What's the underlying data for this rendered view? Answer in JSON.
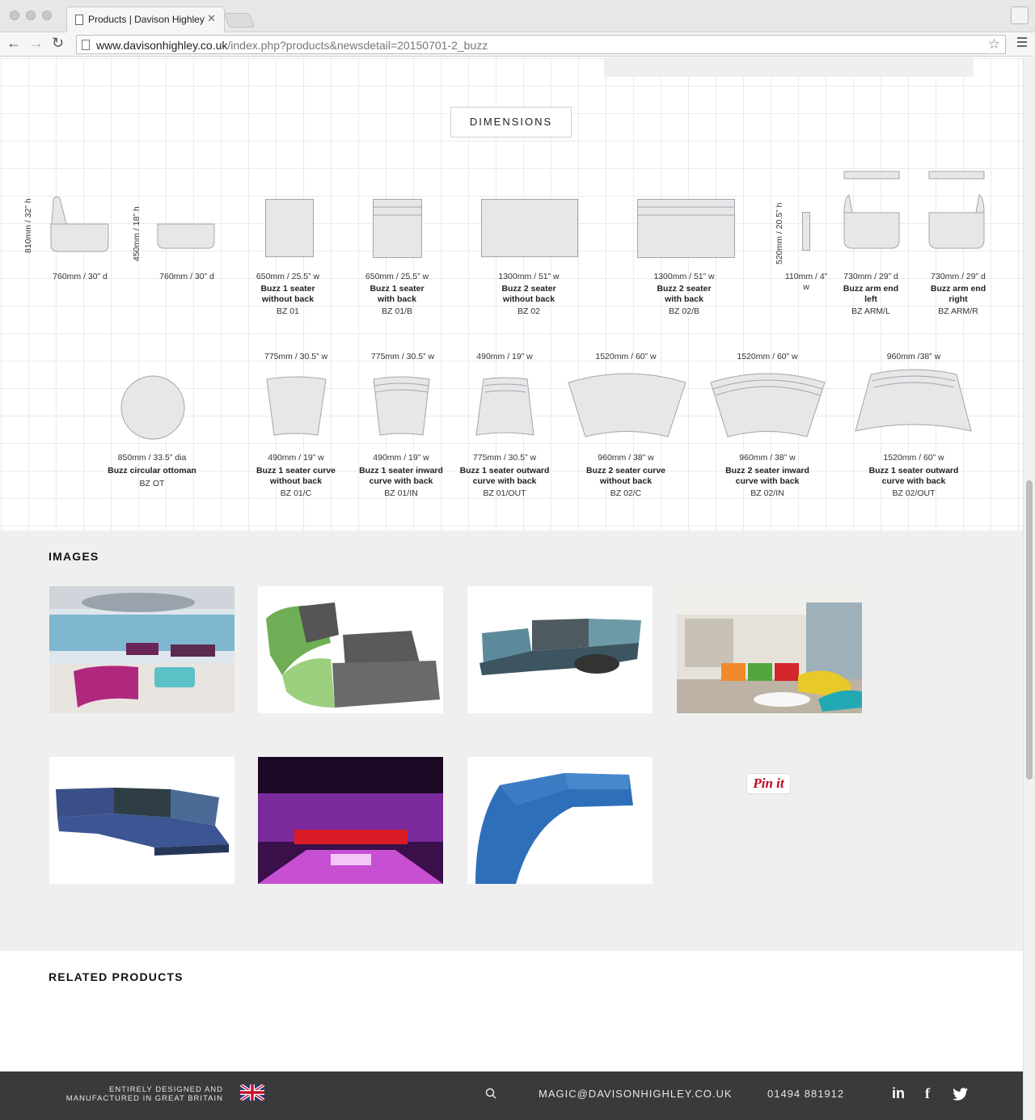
{
  "browser": {
    "tab_title": "Products | Davison Highley",
    "url_host": "www.davisonhighley.co.uk",
    "url_path": "/index.php?products&newsdetail=20150701-2_buzz"
  },
  "dimensions": {
    "title": "DIMENSIONS",
    "row1": [
      {
        "height": "810mm / 32” h",
        "size": "760mm / 30” d"
      },
      {
        "height": "450mm / 18” h",
        "size": "760mm / 30” d"
      },
      {
        "size": "650mm / 25.5” w",
        "name": "Buzz 1 seater without back",
        "code": "BZ 01"
      },
      {
        "size": "650mm / 25.5” w",
        "name": "Buzz 1 seater with back",
        "code": "BZ 01/B"
      },
      {
        "size": "1300mm / 51” w",
        "name": "Buzz 2 seater without back",
        "code": "BZ 02"
      },
      {
        "size": "1300mm / 51” w",
        "name": "Buzz 2 seater with back",
        "code": "BZ 02/B"
      },
      {
        "height": "520mm / 20.5” h",
        "size": "110mm / 4” w"
      },
      {
        "size": "730mm / 29” d",
        "name": "Buzz arm end left",
        "code": "BZ ARM/L"
      },
      {
        "size": "730mm / 29” d",
        "name": "Buzz arm end right",
        "code": "BZ ARM/R"
      }
    ],
    "row2": [
      {
        "top": "",
        "size": "850mm / 33.5” dia",
        "name": "Buzz circular ottoman",
        "code": "BZ OT"
      },
      {
        "top": "775mm / 30.5” w",
        "size": "490mm / 19” w",
        "name": "Buzz 1 seater curve without back",
        "code": "BZ 01/C"
      },
      {
        "top": "775mm / 30.5” w",
        "size": "490mm / 19” w",
        "name": "Buzz 1 seater inward curve with back",
        "code": "BZ 01/IN"
      },
      {
        "top": "490mm / 19” w",
        "size": "775mm / 30.5” w",
        "name": "Buzz 1 seater outward curve with back",
        "code": "BZ 01/OUT"
      },
      {
        "top": "1520mm / 60” w",
        "size": "960mm / 38” w",
        "name": "Buzz 2 seater curve without back",
        "code": "BZ 02/C"
      },
      {
        "top": "1520mm / 60” w",
        "size": "960mm / 38” w",
        "name": "Buzz 2 seater inward curve with back",
        "code": "BZ 02/IN"
      },
      {
        "top": "960mm /38” w",
        "size": "1520mm / 60” w",
        "name": "Buzz 1 seater outward curve with back",
        "code": "BZ 02/OUT"
      }
    ]
  },
  "images": {
    "title": "IMAGES",
    "pin_label": "Pin it"
  },
  "related": {
    "title": "RELATED PRODUCTS"
  },
  "footer": {
    "tagline_1": "ENTIRELY DESIGNED AND",
    "tagline_2": "MANUFACTURED IN GREAT BRITAIN",
    "email": "MAGIC@DAVISONHIGHLEY.CO.UK",
    "phone": "01494 881912",
    "linkedin": "in",
    "facebook": "f"
  }
}
